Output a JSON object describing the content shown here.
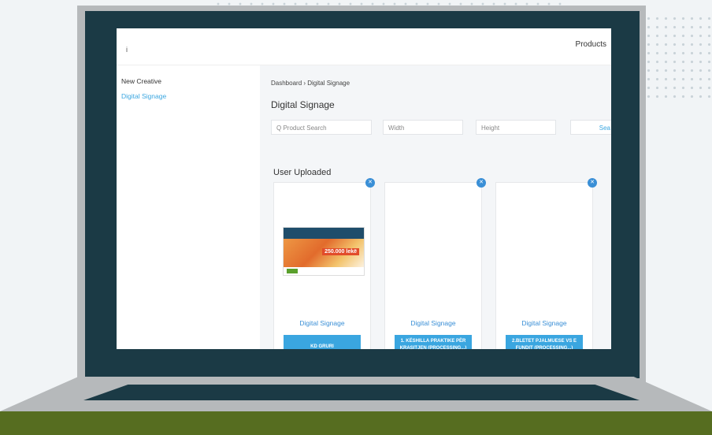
{
  "topbar": {
    "logo_text": "i",
    "products_label": "Products"
  },
  "sidebar": {
    "items": [
      {
        "label": "New Creative"
      },
      {
        "label": "Digital Signage"
      }
    ]
  },
  "main": {
    "breadcrumb": "Dashboard › Digital Signage",
    "title": "Digital Signage",
    "search": {
      "product_placeholder": "Q Product Search",
      "width_placeholder": "Width",
      "height_placeholder": "Height",
      "button_label": "Sea"
    },
    "section_title": "User Uploaded",
    "cards": [
      {
        "label": "Digital Signage",
        "tag": "KD GRURI",
        "thumb_amount": "250.000 lekë"
      },
      {
        "label": "Digital Signage",
        "tag": "1. KËSHILLA PRAKTIKE PËR KRASITJEN (PROCESSING...)"
      },
      {
        "label": "Digital Signage",
        "tag": "2.BLETET PJALMUESE VS E FUNDIT (PROCESSING...)"
      }
    ]
  },
  "colors": {
    "accent": "#3aa6e0",
    "bezel": "#1b3a45",
    "desk": "#566d20"
  }
}
